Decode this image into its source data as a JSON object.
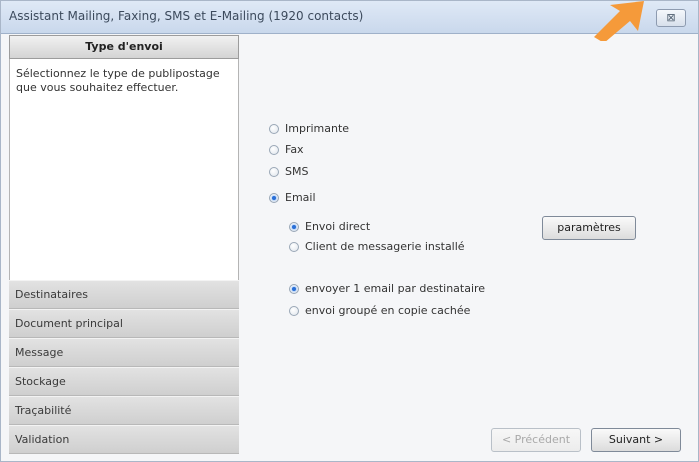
{
  "window": {
    "title": "Assistant Mailing, Faxing, SMS et E-Mailing (1920 contacts)",
    "close_glyph": "⊠"
  },
  "sidebar": {
    "header": "Type d'envoi",
    "description": "Sélectionnez le type de publipostage que vous souhaitez effectuer.",
    "items": [
      {
        "label": "Destinataires"
      },
      {
        "label": "Document principal"
      },
      {
        "label": "Message"
      },
      {
        "label": "Stockage"
      },
      {
        "label": "Traçabilité"
      },
      {
        "label": "Validation"
      }
    ]
  },
  "send_types": [
    {
      "label": "Imprimante",
      "selected": false
    },
    {
      "label": "Fax",
      "selected": false
    },
    {
      "label": "SMS",
      "selected": false
    },
    {
      "label": "Email",
      "selected": true
    }
  ],
  "email_mode": [
    {
      "label": "Envoi direct",
      "selected": true
    },
    {
      "label": "Client de messagerie installé",
      "selected": false
    }
  ],
  "recipient_mode": [
    {
      "label": "envoyer 1 email par destinataire",
      "selected": true
    },
    {
      "label": "envoi groupé en copie cachée",
      "selected": false
    }
  ],
  "buttons": {
    "parametres": "paramètres",
    "previous": "< Précédent",
    "next": "Suivant >"
  },
  "colors": {
    "accent_arrow": "#f59a3a",
    "radio_selected": "#2a6fd6"
  }
}
